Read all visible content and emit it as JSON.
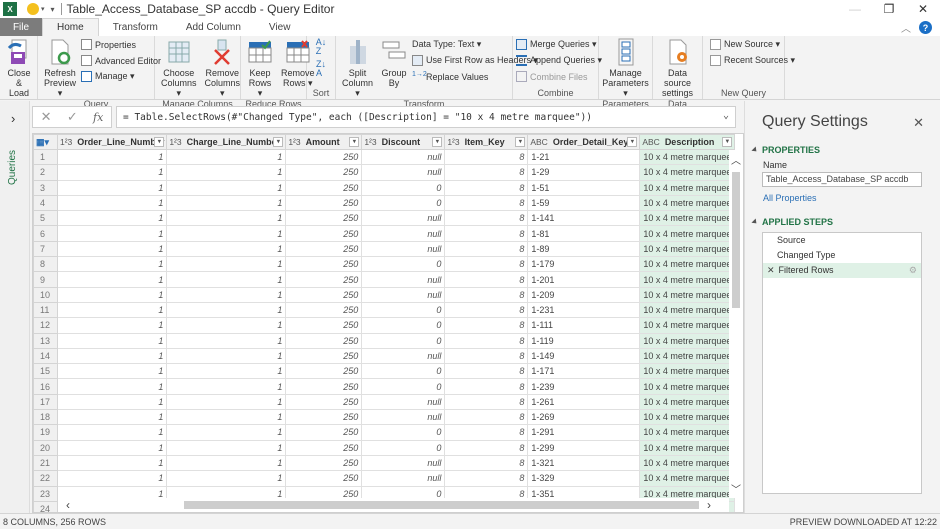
{
  "window": {
    "title": "Table_Access_Database_SP accdb - Query Editor",
    "app_icon": "excel-icon",
    "controls": {
      "minimize": "—",
      "restore": "❐",
      "close": "✕"
    }
  },
  "tabs": [
    {
      "label": "File"
    },
    {
      "label": "Home",
      "active": true
    },
    {
      "label": "Transform"
    },
    {
      "label": "Add Column"
    },
    {
      "label": "View"
    }
  ],
  "ribbon": {
    "groups": [
      {
        "name": "Close",
        "buttons": [
          {
            "label1": "Close &",
            "label2": "Load ▾",
            "icon": "close-load-icon"
          }
        ]
      },
      {
        "name": "Query",
        "buttons": [
          {
            "label1": "Refresh",
            "label2": "Preview ▾",
            "icon": "refresh-icon"
          }
        ],
        "small": [
          {
            "label": "Properties",
            "icon": "properties-icon"
          },
          {
            "label": "Advanced Editor",
            "icon": "advanced-editor-icon"
          },
          {
            "label": "Manage ▾",
            "icon": "manage-icon"
          }
        ]
      },
      {
        "name": "Manage Columns",
        "buttons": [
          {
            "label1": "Choose",
            "label2": "Columns ▾",
            "icon": "choose-columns-icon"
          },
          {
            "label1": "Remove",
            "label2": "Columns ▾",
            "icon": "remove-columns-icon"
          }
        ]
      },
      {
        "name": "Reduce Rows",
        "buttons": [
          {
            "label1": "Keep",
            "label2": "Rows ▾",
            "icon": "keep-rows-icon"
          },
          {
            "label1": "Remove",
            "label2": "Rows ▾",
            "icon": "remove-rows-icon"
          }
        ]
      },
      {
        "name": "Sort",
        "buttons": []
      },
      {
        "name": "Transform",
        "buttons": [
          {
            "label1": "Split",
            "label2": "Column ▾",
            "icon": "split-column-icon"
          },
          {
            "label1": "Group",
            "label2": "By",
            "icon": "group-by-icon"
          }
        ],
        "small": [
          {
            "label": "Data Type: Text ▾"
          },
          {
            "label": "Use First Row as Headers ▾",
            "icon": "headers-icon"
          },
          {
            "label": "Replace Values",
            "icon": "replace-values-icon"
          }
        ]
      },
      {
        "name": "Combine",
        "small": [
          {
            "label": "Merge Queries ▾",
            "icon": "merge-queries-icon"
          },
          {
            "label": "Append Queries ▾",
            "icon": "append-queries-icon"
          },
          {
            "label": "Combine Files",
            "icon": "combine-files-icon",
            "disabled": true
          }
        ]
      },
      {
        "name": "Parameters",
        "buttons": [
          {
            "label1": "Manage",
            "label2": "Parameters ▾",
            "icon": "parameters-icon"
          }
        ]
      },
      {
        "name": "Data Sources",
        "buttons": [
          {
            "label1": "Data source",
            "label2": "settings",
            "icon": "data-source-settings-icon"
          }
        ]
      },
      {
        "name": "New Query",
        "small": [
          {
            "label": "New Source ▾",
            "icon": "new-source-icon"
          },
          {
            "label": "Recent Sources ▾",
            "icon": "recent-sources-icon"
          }
        ]
      }
    ]
  },
  "leftnav": {
    "label": "Queries"
  },
  "formula": {
    "expression": "= Table.SelectRows(#\"Changed Type\", each ([Description] = \"10 x 4 metre marquee\"))",
    "fx": "fx"
  },
  "grid": {
    "columns": [
      {
        "type": "1²3",
        "name": "Order_Line_Number"
      },
      {
        "type": "1²3",
        "name": "Charge_Line_Number"
      },
      {
        "type": "1²3",
        "name": "Amount"
      },
      {
        "type": "1²3",
        "name": "Discount"
      },
      {
        "type": "1²3",
        "name": "Item_Key"
      },
      {
        "type": "ABC",
        "name": "Order_Detail_Key"
      },
      {
        "type": "ABC",
        "name": "Description",
        "filtered": true
      }
    ],
    "rows": [
      [
        "1",
        "1",
        "250",
        "null",
        "8",
        "1-21",
        "10 x 4 metre marquee"
      ],
      [
        "1",
        "1",
        "250",
        "null",
        "8",
        "1-29",
        "10 x 4 metre marquee"
      ],
      [
        "1",
        "1",
        "250",
        "0",
        "8",
        "1-51",
        "10 x 4 metre marquee"
      ],
      [
        "1",
        "1",
        "250",
        "0",
        "8",
        "1-59",
        "10 x 4 metre marquee"
      ],
      [
        "1",
        "1",
        "250",
        "null",
        "8",
        "1-141",
        "10 x 4 metre marquee"
      ],
      [
        "1",
        "1",
        "250",
        "null",
        "8",
        "1-81",
        "10 x 4 metre marquee"
      ],
      [
        "1",
        "1",
        "250",
        "null",
        "8",
        "1-89",
        "10 x 4 metre marquee"
      ],
      [
        "1",
        "1",
        "250",
        "0",
        "8",
        "1-179",
        "10 x 4 metre marquee"
      ],
      [
        "1",
        "1",
        "250",
        "null",
        "8",
        "1-201",
        "10 x 4 metre marquee"
      ],
      [
        "1",
        "1",
        "250",
        "null",
        "8",
        "1-209",
        "10 x 4 metre marquee"
      ],
      [
        "1",
        "1",
        "250",
        "0",
        "8",
        "1-231",
        "10 x 4 metre marquee"
      ],
      [
        "1",
        "1",
        "250",
        "0",
        "8",
        "1-111",
        "10 x 4 metre marquee"
      ],
      [
        "1",
        "1",
        "250",
        "0",
        "8",
        "1-119",
        "10 x 4 metre marquee"
      ],
      [
        "1",
        "1",
        "250",
        "null",
        "8",
        "1-149",
        "10 x 4 metre marquee"
      ],
      [
        "1",
        "1",
        "250",
        "0",
        "8",
        "1-171",
        "10 x 4 metre marquee"
      ],
      [
        "1",
        "1",
        "250",
        "0",
        "8",
        "1-239",
        "10 x 4 metre marquee"
      ],
      [
        "1",
        "1",
        "250",
        "null",
        "8",
        "1-261",
        "10 x 4 metre marquee"
      ],
      [
        "1",
        "1",
        "250",
        "null",
        "8",
        "1-269",
        "10 x 4 metre marquee"
      ],
      [
        "1",
        "1",
        "250",
        "0",
        "8",
        "1-291",
        "10 x 4 metre marquee"
      ],
      [
        "1",
        "1",
        "250",
        "0",
        "8",
        "1-299",
        "10 x 4 metre marquee"
      ],
      [
        "1",
        "1",
        "250",
        "null",
        "8",
        "1-321",
        "10 x 4 metre marquee"
      ],
      [
        "1",
        "1",
        "250",
        "null",
        "8",
        "1-329",
        "10 x 4 metre marquee"
      ],
      [
        "1",
        "1",
        "250",
        "0",
        "8",
        "1-351",
        "10 x 4 metre marquee"
      ],
      [
        "",
        "",
        "",
        "",
        "",
        "",
        ""
      ]
    ]
  },
  "settings": {
    "title": "Query Settings",
    "properties_header": "PROPERTIES",
    "name_label": "Name",
    "name_value": "Table_Access_Database_SP accdb",
    "all_properties": "All Properties",
    "steps_header": "APPLIED STEPS",
    "steps": [
      {
        "label": "Source"
      },
      {
        "label": "Changed Type"
      },
      {
        "label": "Filtered Rows",
        "active": true
      }
    ]
  },
  "status": {
    "left": "8 COLUMNS, 256 ROWS",
    "right": "PREVIEW DOWNLOADED AT 12:22"
  },
  "colors": {
    "accent_green": "#217346",
    "selected_column": "#dff1e6",
    "file_tab": "#7c7c7c",
    "link": "#2a6fb5"
  }
}
